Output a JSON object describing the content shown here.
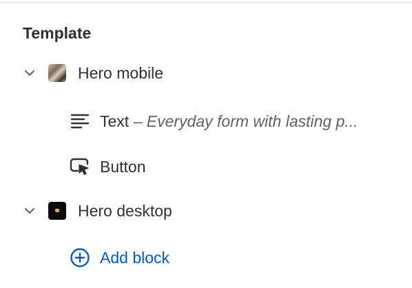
{
  "template": {
    "title": "Template",
    "sections": [
      {
        "name": "Hero mobile",
        "thumbnail": "hero-mobile-thumbnail",
        "expanded": true,
        "blocks": [
          {
            "type_label": "Text",
            "separator": "–",
            "preview": "Everyday form with lasting p...",
            "icon": "text-lines-icon"
          },
          {
            "type_label": "Button",
            "icon": "button-cursor-icon"
          }
        ]
      },
      {
        "name": "Hero desktop",
        "thumbnail": "hero-desktop-thumbnail",
        "expanded": true,
        "add_block_label": "Add block",
        "add_block_icon": "plus-circle-icon"
      }
    ]
  },
  "colors": {
    "text": "#303030",
    "secondary_text": "#616161",
    "link": "#005bd3"
  }
}
